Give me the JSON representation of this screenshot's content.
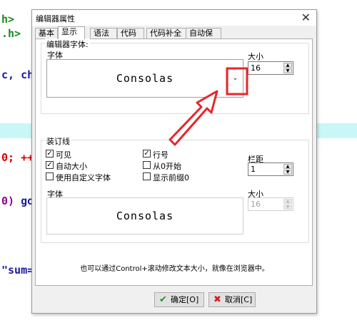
{
  "background_code": {
    "line1": "h>",
    "line2": ".h>",
    "line3_a": "c, ",
    "line3_b": "ch",
    "line4_a": "0; ",
    "line4_b": "++",
    "line5_a": "0) ",
    "line5_b": "go",
    "line6": "\"sum="
  },
  "dialog": {
    "title": "编辑器属性",
    "close_glyph": "✕",
    "tabs": [
      "基本",
      "显示",
      "语法",
      "代码",
      "代码补全",
      "自动保存"
    ],
    "active_tab": "显示",
    "editor_font_group": {
      "title": "编辑器字体:",
      "font_label": "字体",
      "font_value": "Consolas",
      "size_label": "大小",
      "size_value": "16",
      "dropdown_icon": "chevron-down"
    },
    "gutter_group": {
      "title": "装订线",
      "checkboxes": [
        {
          "label": "可见",
          "checked": true
        },
        {
          "label": "行号",
          "checked": true
        },
        {
          "label": "自动大小",
          "checked": true
        },
        {
          "label": "从0开始",
          "checked": false
        },
        {
          "label": "使用自定义字体",
          "checked": false
        },
        {
          "label": "显示前缀0",
          "checked": false
        }
      ],
      "margin_label": "栏距",
      "margin_value": "1",
      "font_label": "字体",
      "font_value": "Consolas",
      "size_label": "大小",
      "size_value": "16"
    },
    "hint": "也可以通过Control+滚动修改文本大小，就像在浏览器中。",
    "ok_button": "确定[O]",
    "cancel_button": "取消[C]"
  },
  "colors": {
    "annotation_red": "#e8262b",
    "code_green": "#1a8a1a",
    "code_blue": "#1a1aa0",
    "code_red": "#d40000",
    "code_purple": "#8b008b",
    "band_cyan": "#c9f6f6"
  }
}
